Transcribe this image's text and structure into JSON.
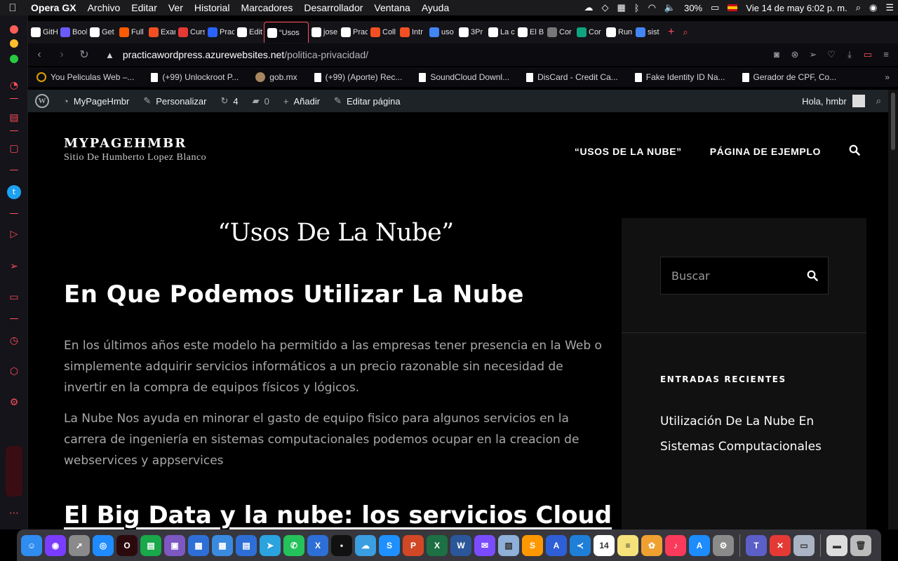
{
  "menubar": {
    "app": "Opera GX",
    "items": [
      "Archivo",
      "Editar",
      "Ver",
      "Historial",
      "Marcadores",
      "Desarrollador",
      "Ventana",
      "Ayuda"
    ],
    "battery": "30%",
    "datetime": "Vie 14 de may  6:02 p. m."
  },
  "tabs": [
    {
      "label": "GitH",
      "color": "#ffffff"
    },
    {
      "label": "Bool",
      "color": "#6b5bff"
    },
    {
      "label": "Get",
      "color": "#ffffff"
    },
    {
      "label": "Full",
      "color": "#ff5a00"
    },
    {
      "label": "Exar",
      "color": "#f25022"
    },
    {
      "label": "Curs",
      "color": "#e53935"
    },
    {
      "label": "Prac",
      "color": "#2962ff"
    },
    {
      "label": "Edit",
      "color": "#ffffff"
    },
    {
      "label": "“Usos",
      "color": "#ffffff",
      "active": true
    },
    {
      "label": "jose",
      "color": "#ffffff"
    },
    {
      "label": "Prac",
      "color": "#ffffff"
    },
    {
      "label": "Coll",
      "color": "#f25022"
    },
    {
      "label": "Intr",
      "color": "#f25022"
    },
    {
      "label": "uso",
      "color": "#4285f4"
    },
    {
      "label": "3Pr",
      "color": "#ffffff"
    },
    {
      "label": "La c",
      "color": "#ffffff"
    },
    {
      "label": "El B",
      "color": "#ffffff"
    },
    {
      "label": "Cor",
      "color": "#777777"
    },
    {
      "label": "Cor",
      "color": "#10a37f"
    },
    {
      "label": "Run",
      "color": "#ffffff"
    },
    {
      "label": "sist",
      "color": "#4285f4"
    }
  ],
  "address": {
    "host": "practicawordpress.azurewebsites.net",
    "path": "/politica-privacidad/"
  },
  "bookmarks": [
    {
      "label": "You Peliculas Web –...",
      "icon": "ring"
    },
    {
      "label": "(+99) Unlockroot P...",
      "icon": "doc"
    },
    {
      "label": "gob.mx",
      "icon": "dot"
    },
    {
      "label": "(+99) (Aporte) Rec...",
      "icon": "doc"
    },
    {
      "label": "SoundCloud Downl...",
      "icon": "doc"
    },
    {
      "label": "DisCard - Credit Ca...",
      "icon": "doc"
    },
    {
      "label": "Fake Identity ID Na...",
      "icon": "doc"
    },
    {
      "label": "Gerador de CPF, Co...",
      "icon": "doc"
    }
  ],
  "wpbar": {
    "site": "MyPageHmbr",
    "customize": "Personalizar",
    "updates": "4",
    "comments": "0",
    "add_new": "Añadir",
    "edit_page": "Editar página",
    "greeting": "Hola, hmbr"
  },
  "site": {
    "title": "MYPAGEHMBR",
    "subtitle": "Sitio De Humberto Lopez Blanco",
    "nav": [
      "“USOS DE LA NUBE”",
      "PÁGINA DE EJEMPLO"
    ]
  },
  "article": {
    "page_title": "“Usos De La Nube”",
    "heading": "En Que Podemos Utilizar La Nube",
    "p1": "En los últimos años este modelo ha permitido a las empresas tener presencia en la Web o simplemente adquirir servicios informáticos a un precio razonable sin necesidad de invertir en la compra de equipos físicos y lógicos.",
    "p2": "La Nube Nos ayuda en minorar el gasto de equipo fisico para algunos servicios en la carrera de ingeniería en sistemas computacionales podemos ocupar en la creacion de webservices y appservices",
    "heading2": "El Big Data y la nube: los servicios Cloud"
  },
  "aside": {
    "search_placeholder": "Buscar",
    "recent_heading": "ENTRADAS RECIENTES",
    "recent_link": "Utilización De La Nube En Sistemas Computacionales"
  },
  "colors": {
    "accent": "#ff4d5a",
    "wp_bar": "#1d2327",
    "aside_bg": "#111111"
  },
  "dock": [
    {
      "name": "finder",
      "color": "#2f8cf0",
      "glyph": "☺"
    },
    {
      "name": "siri",
      "color": "#7a3cff",
      "glyph": "◉"
    },
    {
      "name": "launchpad",
      "color": "#8a8a8a",
      "glyph": "➚"
    },
    {
      "name": "safari",
      "color": "#1f8bff",
      "glyph": "◎"
    },
    {
      "name": "opera",
      "color": "#2b0a0e",
      "glyph": "O"
    },
    {
      "name": "app-green",
      "color": "#19a84a",
      "glyph": "▤"
    },
    {
      "name": "app-purple",
      "color": "#7d57c2",
      "glyph": "▣"
    },
    {
      "name": "app-blue-1",
      "color": "#2d6fd6",
      "glyph": "▦"
    },
    {
      "name": "app-blue-2",
      "color": "#3a8be0",
      "glyph": "▦"
    },
    {
      "name": "app-blue-3",
      "color": "#2d6fd6",
      "glyph": "▤"
    },
    {
      "name": "telegram",
      "color": "#2aa3df",
      "glyph": "➤"
    },
    {
      "name": "whatsapp",
      "color": "#25c15a",
      "glyph": "✆"
    },
    {
      "name": "x-app",
      "color": "#2d6fd6",
      "glyph": "X"
    },
    {
      "name": "dark-app",
      "color": "#111111",
      "glyph": "•"
    },
    {
      "name": "cloud-app",
      "color": "#3a9ee0",
      "glyph": "☁"
    },
    {
      "name": "skype",
      "color": "#1e90ff",
      "glyph": "S"
    },
    {
      "name": "powerpoint",
      "color": "#d24726",
      "glyph": "P"
    },
    {
      "name": "excel",
      "color": "#1d7044",
      "glyph": "X"
    },
    {
      "name": "word",
      "color": "#2b579a",
      "glyph": "W"
    },
    {
      "name": "messenger",
      "color": "#7b4cff",
      "glyph": "✉"
    },
    {
      "name": "preview",
      "color": "#8fb0d8",
      "glyph": "▧"
    },
    {
      "name": "sublime",
      "color": "#ff9800",
      "glyph": "S"
    },
    {
      "name": "xcode-app",
      "color": "#2f5fd6",
      "glyph": "A"
    },
    {
      "name": "vscode",
      "color": "#1f7fd8",
      "glyph": "≺"
    },
    {
      "name": "calendar",
      "color": "#ffffff",
      "glyph": "14"
    },
    {
      "name": "notes",
      "color": "#f5e27a",
      "glyph": "≡"
    },
    {
      "name": "photos",
      "color": "#f0a030",
      "glyph": "✿"
    },
    {
      "name": "music",
      "color": "#fa3a5a",
      "glyph": "♪"
    },
    {
      "name": "app-store",
      "color": "#1c8cff",
      "glyph": "A"
    },
    {
      "name": "system-preferences",
      "color": "#8a8a8a",
      "glyph": "⚙"
    },
    {
      "name": "teams",
      "color": "#5b5fc7",
      "glyph": "T"
    },
    {
      "name": "remote-app",
      "color": "#e53935",
      "glyph": "✕"
    },
    {
      "name": "disk-utility",
      "color": "#aab4c4",
      "glyph": "▭"
    },
    {
      "name": "downloads-stack",
      "color": "#dddddd",
      "glyph": "▬"
    },
    {
      "name": "trash",
      "color": "#bbbbbb",
      "glyph": "🗑"
    }
  ]
}
